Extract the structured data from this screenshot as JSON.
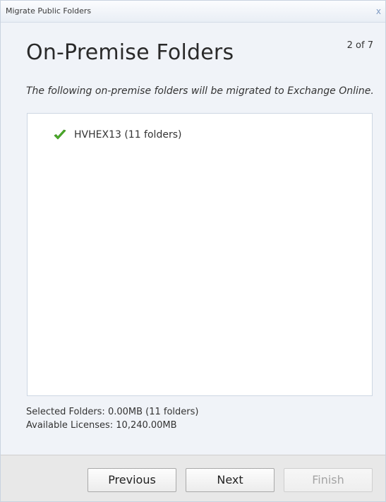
{
  "window": {
    "title": "Migrate Public Folders",
    "close_label": "x"
  },
  "header": {
    "heading": "On-Premise Folders",
    "step": "2 of 7"
  },
  "description": "The following on-premise folders will be migrated to Exchange Online.",
  "folders": [
    {
      "label": "HVHEX13 (11 folders)",
      "icon": "check-icon",
      "status_color": "#4caf2a"
    }
  ],
  "summary": {
    "selected": "Selected Folders: 0.00MB (11 folders)",
    "available": "Available Licenses: 10,240.00MB"
  },
  "buttons": {
    "previous": "Previous",
    "next": "Next",
    "finish": "Finish"
  }
}
